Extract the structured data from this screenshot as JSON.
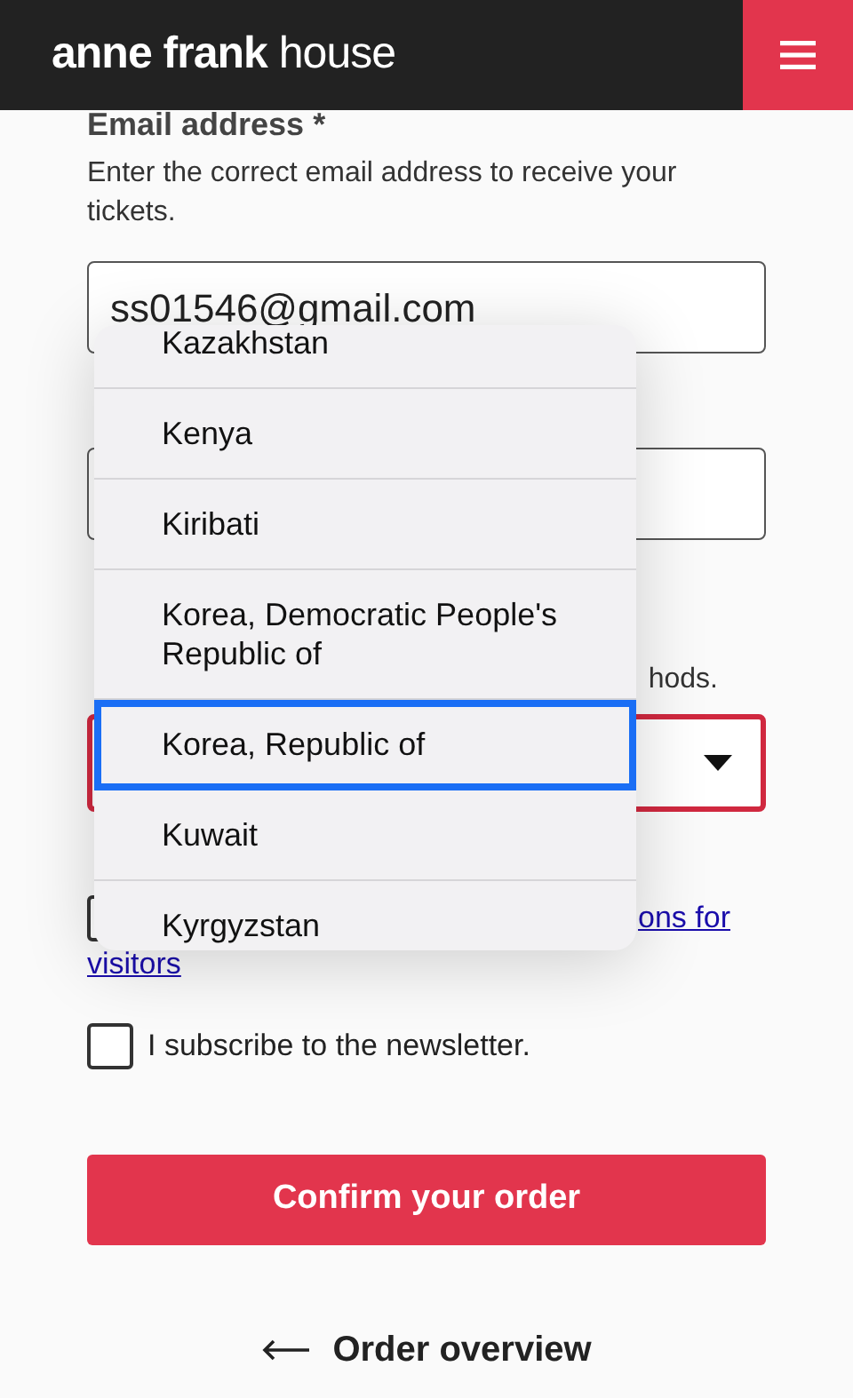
{
  "header": {
    "logo_bold": "anne frank",
    "logo_light": "house"
  },
  "form": {
    "email_label": "Email address *",
    "email_help": "Enter the correct email address to receive your tickets.",
    "email_value": "ss01546@gmail.com",
    "country_help_fragment": "hods.",
    "country_select": {
      "invalid": true
    },
    "terms": {
      "checked": false,
      "link_parts": [
        "ons for",
        "visitors"
      ]
    },
    "newsletter": {
      "checked": false,
      "label": "I subscribe to the newsletter."
    },
    "confirm_button": "Confirm your order",
    "back_link": "Order overview"
  },
  "country_picker": {
    "options": [
      {
        "label": "Kazakhstan",
        "selected": false
      },
      {
        "label": "Kenya",
        "selected": false
      },
      {
        "label": "Kiribati",
        "selected": false
      },
      {
        "label": "Korea, Democratic People's Republic of",
        "selected": false
      },
      {
        "label": "Korea, Republic of",
        "selected": true
      },
      {
        "label": "Kuwait",
        "selected": false
      },
      {
        "label": "Kyrgyzstan",
        "selected": false
      }
    ]
  }
}
